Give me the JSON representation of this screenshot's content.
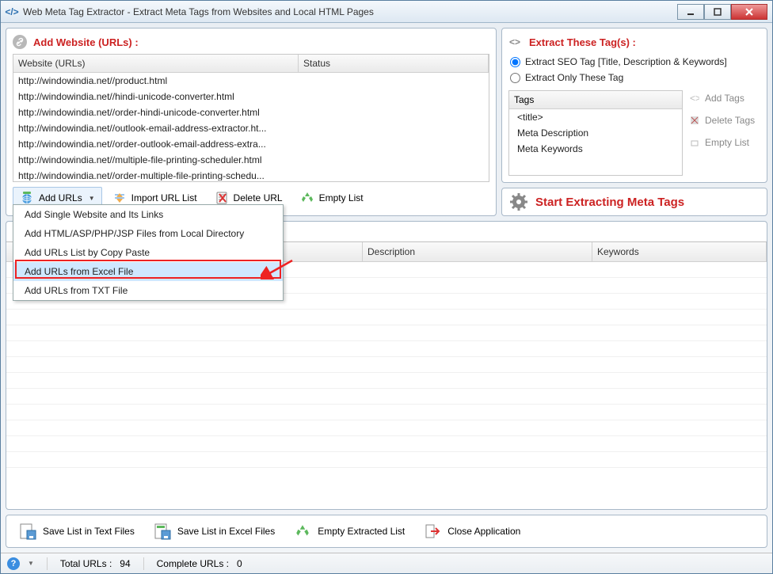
{
  "window": {
    "title": "Web Meta Tag Extractor - Extract Meta Tags from Websites and Local HTML Pages"
  },
  "addSection": {
    "title": "Add Website (URLs) :",
    "cols": {
      "url": "Website (URLs)",
      "status": "Status"
    },
    "rows": [
      "http://windowindia.net//product.html",
      "http://windowindia.net//hindi-unicode-converter.html",
      "http://windowindia.net//order-hindi-unicode-converter.html",
      "http://windowindia.net//outlook-email-address-extractor.ht...",
      "http://windowindia.net//order-outlook-email-address-extra...",
      "http://windowindia.net//multiple-file-printing-scheduler.html",
      "http://windowindia.net//order-multiple-file-printing-schedu..."
    ],
    "toolbar": {
      "addUrls": "Add URLs",
      "importList": "Import URL List",
      "deleteUrl": "Delete URL",
      "emptyList": "Empty List"
    },
    "dropdown": [
      "Add Single Website and Its Links",
      "Add HTML/ASP/PHP/JSP Files from Local Directory",
      "Add URLs List by Copy Paste",
      "Add URLs from Excel File",
      "Add URLs from TXT File"
    ]
  },
  "extractSection": {
    "title": "Extract These Tag(s) :",
    "radio1": "Extract SEO Tag [Title, Description & Keywords]",
    "radio2": "Extract Only These Tag",
    "tagsHeader": "Tags",
    "tags": [
      "<title>",
      "Meta Description",
      "Meta Keywords"
    ],
    "btnAdd": "Add Tags",
    "btnDelete": "Delete Tags",
    "btnEmpty": "Empty List"
  },
  "startButton": "Start Extracting Meta Tags",
  "results": {
    "cols": {
      "c1": "",
      "c2": "",
      "c3": "Description",
      "c4": "Keywords"
    }
  },
  "bottomActions": {
    "saveTxt": "Save List in Text Files",
    "saveXls": "Save List in Excel Files",
    "empty": "Empty Extracted List",
    "close": "Close Application"
  },
  "statusbar": {
    "totalLabel": "Total URLs :",
    "totalVal": "94",
    "completeLabel": "Complete URLs :",
    "completeVal": "0"
  }
}
